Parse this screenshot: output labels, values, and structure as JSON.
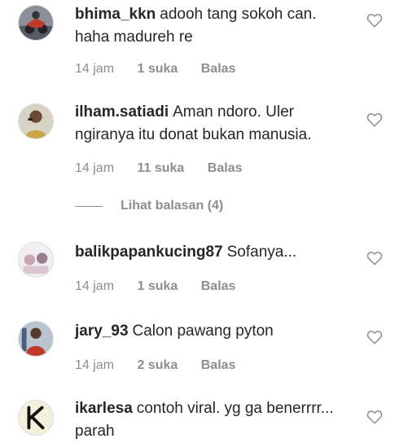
{
  "comments": [
    {
      "username": "bhima_kkn",
      "text": "adooh tang sokoh can. haha madureh re",
      "time": "14 jam",
      "likes": "1 suka",
      "reply": "Balas",
      "avatar_icon": "avatar-motorbike"
    },
    {
      "username": "ilham.satiadi",
      "text": "Aman ndoro. Uler ngiranya itu donat bukan manusia.",
      "time": "14 jam",
      "likes": "11 suka",
      "reply": "Balas",
      "avatar_icon": "avatar-person"
    },
    {
      "username": "balikpapankucing87",
      "text": "Sofanya...",
      "time": "14 jam",
      "likes": "1 suka",
      "reply": "Balas",
      "avatar_icon": "avatar-cats"
    },
    {
      "username": "jary_93",
      "text": "Calon pawang pyton",
      "time": "14 jam",
      "likes": "2 suka",
      "reply": "Balas",
      "avatar_icon": "avatar-person-red"
    },
    {
      "username": "ikarlesa",
      "text": "contoh viral. yg ga benerrrr... parah",
      "avatar_icon": "avatar-letter-k"
    }
  ],
  "view_replies": "Lihat balasan (4)",
  "colors": {
    "text": "#262626",
    "secondary": "#8e8e8e",
    "background": "#ffffff"
  }
}
